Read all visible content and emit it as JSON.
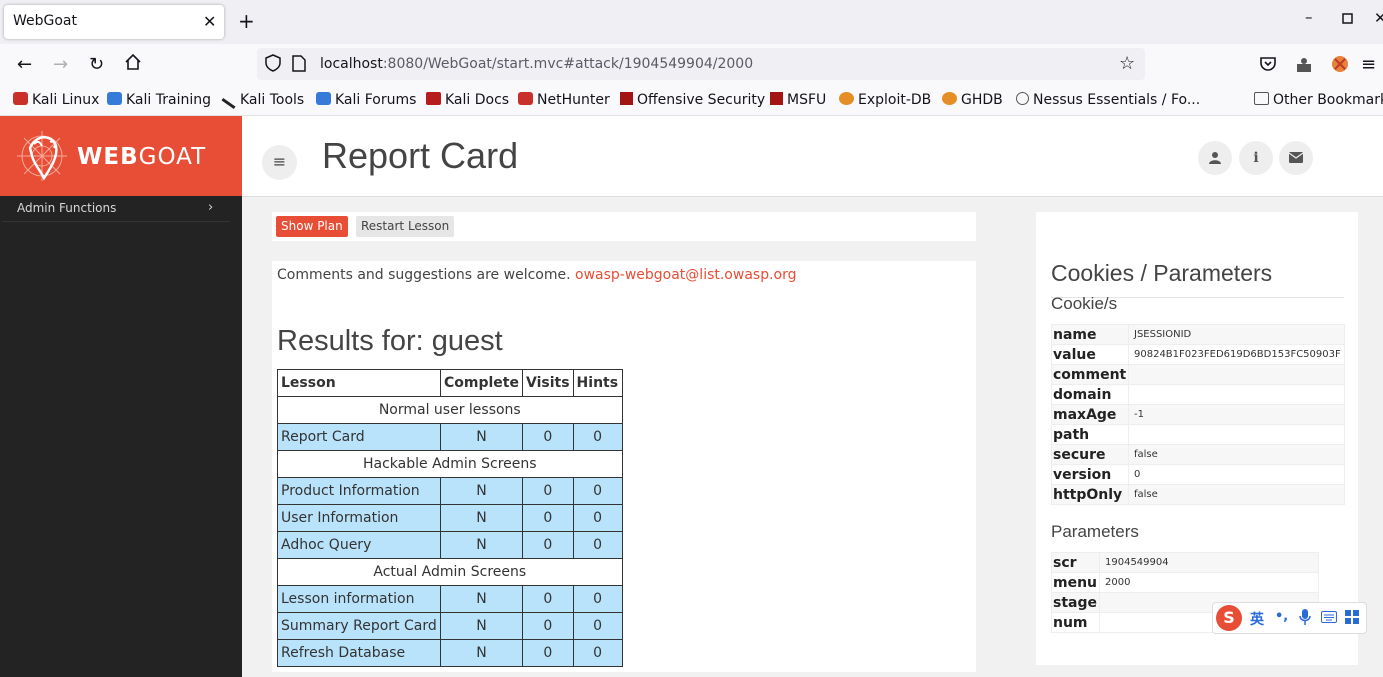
{
  "browser": {
    "tab_title": "WebGoat",
    "tab_close": "✕",
    "new_tab": "+",
    "url_host": "localhost",
    "url_path": ":8080/WebGoat/start.mvc#attack/1904549904/2000",
    "bookmarks": [
      "Kali Linux",
      "Kali Training",
      "Kali Tools",
      "Kali Forums",
      "Kali Docs",
      "NetHunter",
      "Offensive Security",
      "MSFU",
      "Exploit-DB",
      "GHDB",
      "Nessus Essentials / Fo..."
    ],
    "other_bookmarks": "Other Bookmarks"
  },
  "logo": {
    "bold": "WEB",
    "rest": "GOAT"
  },
  "sidebar": {
    "items": [
      {
        "label": "Admin Functions",
        "chevron": "›"
      }
    ]
  },
  "header": {
    "title": "Report Card",
    "menu_icon": "≡"
  },
  "toolbar": {
    "show_plan": "Show Plan",
    "restart": "Restart Lesson"
  },
  "main": {
    "comments": "Comments and suggestions are welcome.",
    "email": "owasp-webgoat@list.owasp.org",
    "results_title": "Results for: guest",
    "table": {
      "headers": [
        "Lesson",
        "Complete",
        "Visits",
        "Hints"
      ],
      "sections": [
        {
          "title": "Normal user lessons",
          "rows": [
            [
              "Report Card",
              "N",
              "0",
              "0"
            ]
          ]
        },
        {
          "title": "Hackable Admin Screens",
          "rows": [
            [
              "Product Information",
              "N",
              "0",
              "0"
            ],
            [
              "User Information",
              "N",
              "0",
              "0"
            ],
            [
              "Adhoc Query",
              "N",
              "0",
              "0"
            ]
          ]
        },
        {
          "title": "Actual Admin Screens",
          "rows": [
            [
              "Lesson information",
              "N",
              "0",
              "0"
            ],
            [
              "Summary Report Card",
              "N",
              "0",
              "0"
            ],
            [
              "Refresh Database",
              "N",
              "0",
              "0"
            ]
          ]
        }
      ]
    }
  },
  "cookies_panel": {
    "title": "Cookies / Parameters",
    "cookies_title": "Cookie/s",
    "cookies": [
      [
        "name",
        "JSESSIONID"
      ],
      [
        "value",
        "90824B1F023FED619D6BD153FC50903F"
      ],
      [
        "comment",
        ""
      ],
      [
        "domain",
        ""
      ],
      [
        "maxAge",
        "-1"
      ],
      [
        "path",
        ""
      ],
      [
        "secure",
        "false"
      ],
      [
        "version",
        "0"
      ],
      [
        "httpOnly",
        "false"
      ]
    ],
    "params_title": "Parameters",
    "params": [
      [
        "scr",
        "1904549904"
      ],
      [
        "menu",
        "2000"
      ],
      [
        "stage",
        ""
      ],
      [
        "num",
        ""
      ]
    ]
  },
  "ime": {
    "logo": "S",
    "lang": "英",
    "punct": "•,"
  },
  "colors": {
    "accent": "#e84d35",
    "sidebar": "#232323",
    "row": "#b9e3fb"
  }
}
